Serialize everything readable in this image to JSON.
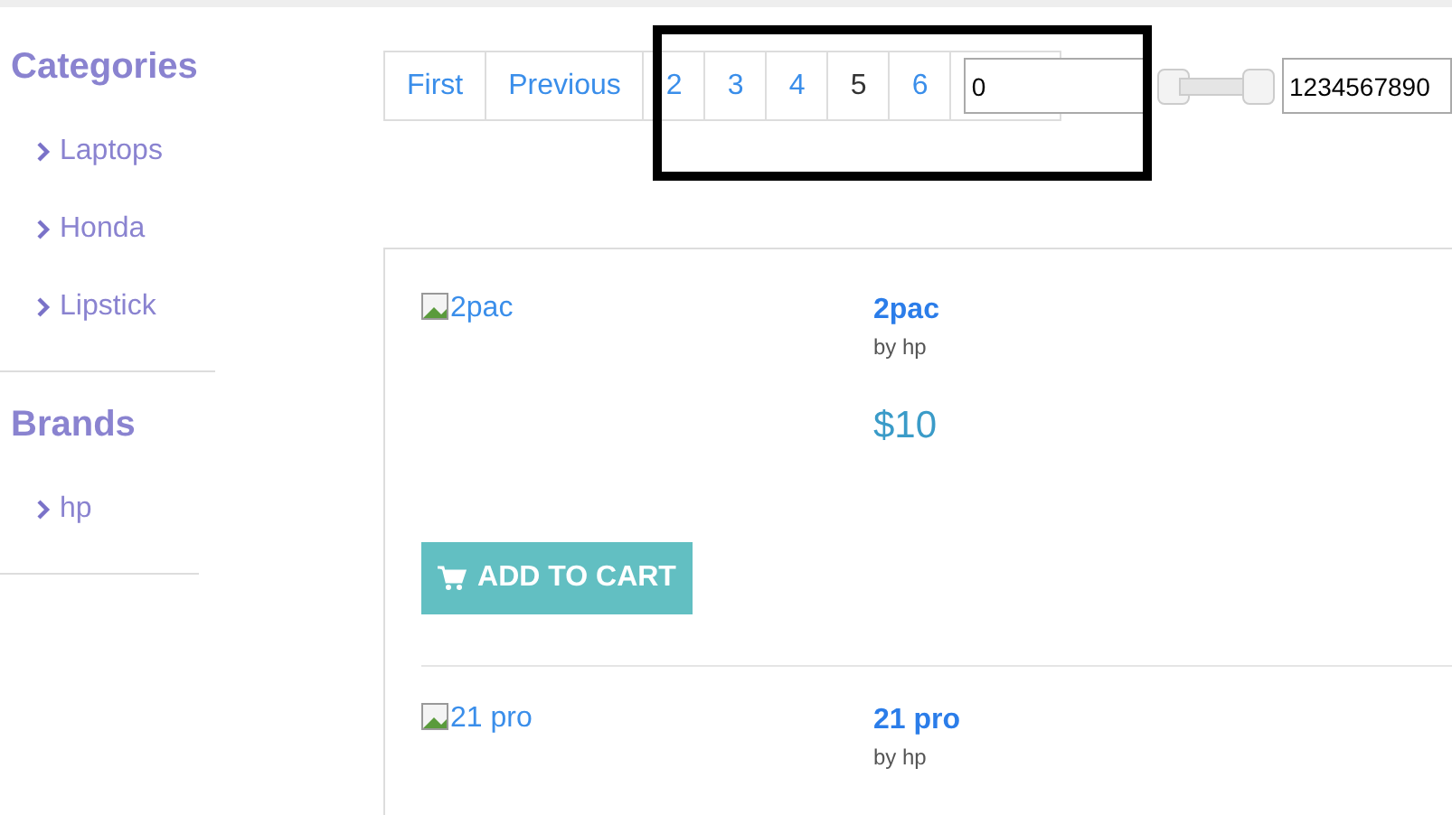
{
  "sidebar": {
    "sections": [
      {
        "title": "Categories",
        "items": [
          "Laptops",
          "Honda",
          "Lipstick"
        ]
      },
      {
        "title": "Brands",
        "items": [
          "hp"
        ]
      }
    ]
  },
  "pagination": {
    "pages": [
      {
        "label": "First",
        "selected": false
      },
      {
        "label": "Previous",
        "selected": false
      },
      {
        "label": "2",
        "selected": false
      },
      {
        "label": "3",
        "selected": false
      },
      {
        "label": "4",
        "selected": false
      },
      {
        "label": "5",
        "selected": true
      },
      {
        "label": "6",
        "selected": false
      }
    ],
    "page_input": {
      "value": "0"
    },
    "slider": {
      "level": 1
    },
    "number_input": {
      "value": "1234567890"
    }
  },
  "products": [
    {
      "image_alt": "2pac",
      "name": "2pac",
      "brand": "by hp",
      "price": "$10",
      "button": "ADD TO CART"
    },
    {
      "image_alt": "21 pro",
      "name": "21 pro",
      "brand": "by hp"
    }
  ]
}
